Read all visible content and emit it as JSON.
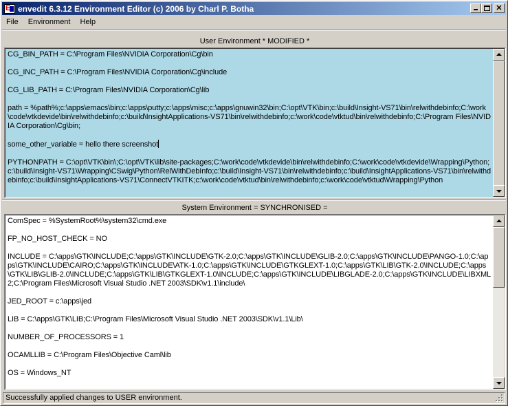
{
  "window": {
    "title": "envedit 6.3.12 Environment Editor (c) 2006 by Charl P. Botha"
  },
  "menu": [
    "File",
    "Environment",
    "Help"
  ],
  "user_env": {
    "label": "User Environment  * MODIFIED *",
    "entries": [
      "CG_BIN_PATH = C:\\Program Files\\NVIDIA Corporation\\Cg\\bin",
      "CG_INC_PATH = C:\\Program Files\\NVIDIA Corporation\\Cg\\include",
      "CG_LIB_PATH = C:\\Program Files\\NVIDIA Corporation\\Cg\\lib",
      "path = %path%;c:\\apps\\emacs\\bin;c:\\apps\\putty;c:\\apps\\misc;c:\\apps\\gnuwin32\\bin;C:\\opt\\VTK\\bin;c:\\build\\Insight-VS71\\bin\\relwithdebinfo;C:\\work\\code\\vtkdevide\\bin\\relwithdebinfo;c:\\build\\InsightApplications-VS71\\bin\\relwithdebinfo;c:\\work\\code\\vtktud\\bin\\relwithdebinfo;C:\\Program Files\\NVIDIA Corporation\\Cg\\bin;",
      "some_other_variable = hello there screenshot",
      "PYTHONPATH = C:\\opt\\VTK\\bin\\;C:\\opt\\VTK\\lib\\site-packages;C:\\work\\code\\vtkdevide\\bin\\relwithdebinfo;C:\\work\\code\\vtkdevide\\Wrapping\\Python;c:\\build\\Insight-VS71\\Wrapping\\CSwig\\Python\\RelWithDebInfo;c:\\build\\Insight-VS71\\bin\\relwithdebinfo;c:\\build\\InsightApplications-VS71\\bin\\relwithdebinfo;c:\\build\\InsightApplications-VS71\\ConnectVTKITK;c:\\work\\code\\vtktud\\bin\\relwithdebinfo;c:\\work\\code\\vtktud\\Wrapping\\Python"
    ]
  },
  "system_env": {
    "label": "System Environment  = SYNCHRONISED =",
    "entries": [
      "ComSpec = %SystemRoot%\\system32\\cmd.exe",
      "FP_NO_HOST_CHECK = NO",
      "INCLUDE = C:\\apps\\GTK\\INCLUDE;C:\\apps\\GTK\\INCLUDE\\GTK-2.0;C:\\apps\\GTK\\INCLUDE\\GLIB-2.0;C:\\apps\\GTK\\INCLUDE\\PANGO-1.0;C:\\apps\\GTK\\INCLUDE\\CAIRO;C:\\apps\\GTK\\INCLUDE\\ATK-1.0;C:\\apps\\GTK\\INCLUDE\\GTKGLEXT-1.0;C:\\apps\\GTK\\LIB\\GTK-2.0\\INCLUDE;C:\\apps\\GTK\\LIB\\GLIB-2.0\\INCLUDE;C:\\apps\\GTK\\LIB\\GTKGLEXT-1.0\\INCLUDE;C:\\apps\\GTK\\INCLUDE\\LIBGLADE-2.0;C:\\apps\\GTK\\INCLUDE\\LIBXML2;C:\\Program Files\\Microsoft Visual Studio .NET 2003\\SDK\\v1.1\\include\\",
      "JED_ROOT = c:\\apps\\jed",
      "LIB = C:\\apps\\GTK\\LIB;C:\\Program Files\\Microsoft Visual Studio .NET 2003\\SDK\\v1.1\\Lib\\",
      "NUMBER_OF_PROCESSORS = 1",
      "OCAMLLIB = C:\\Program Files\\Objective Caml\\lib",
      "OS = Windows_NT"
    ]
  },
  "status": "Successfully applied changes to USER environment."
}
